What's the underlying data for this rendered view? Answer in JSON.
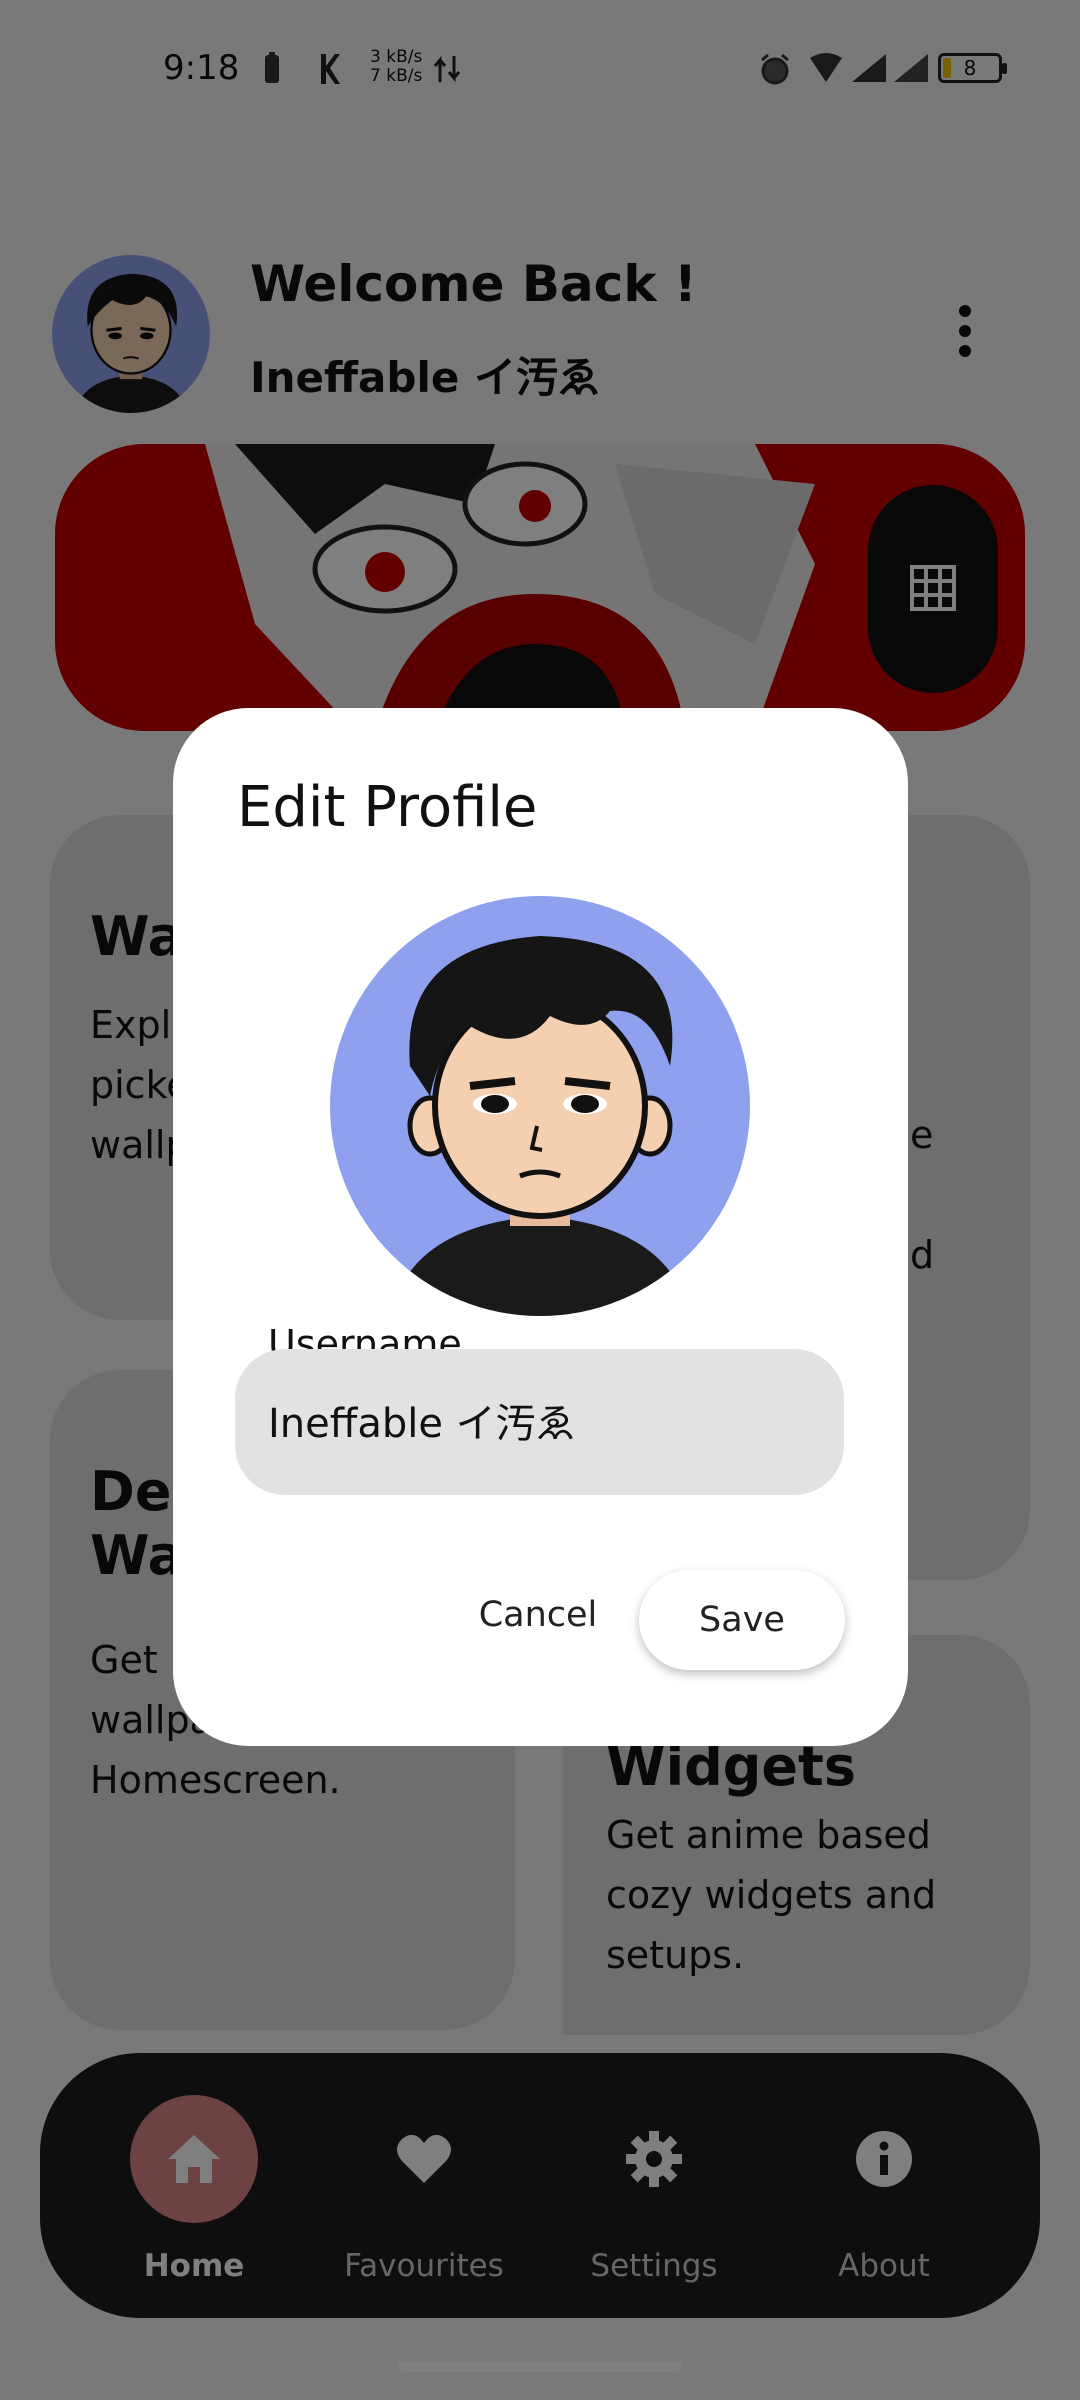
{
  "status_bar": {
    "time": "9:18",
    "net_up": "3 kB/s",
    "net_down": "7 kB/s",
    "battery": "8"
  },
  "header": {
    "title": "Welcome Back !",
    "username": "Ineffable イ汚ゑ"
  },
  "cards": [
    {
      "title": "Wa",
      "desc_lines": [
        "Expl",
        "picke",
        "wallp"
      ]
    },
    {
      "title_lines": [
        "Dep",
        "Wa"
      ],
      "desc_lines": [
        "Get l",
        "wallpa",
        "Homescreen."
      ]
    },
    {
      "desc_lines": [
        "e",
        "d"
      ]
    },
    {
      "title": "Widgets",
      "desc_lines": [
        "Get anime based",
        "cozy widgets and",
        "setups."
      ]
    }
  ],
  "bottom_nav": [
    {
      "label": "Home",
      "icon": "home-icon",
      "active": true
    },
    {
      "label": "Favourites",
      "icon": "heart-icon",
      "active": false
    },
    {
      "label": "Settings",
      "icon": "gear-icon",
      "active": false
    },
    {
      "label": "About",
      "icon": "info-icon",
      "active": false
    }
  ],
  "dialog": {
    "title": "Edit Profile",
    "field_label": "Username",
    "field_value": "Ineffable イ汚ゑ",
    "cancel_label": "Cancel",
    "save_label": "Save"
  },
  "colors": {
    "avatar_bg": "#8fa0ef",
    "banner_red": "#c80000",
    "nav_bg": "#1c1c1c",
    "nav_active": "#d98484"
  }
}
